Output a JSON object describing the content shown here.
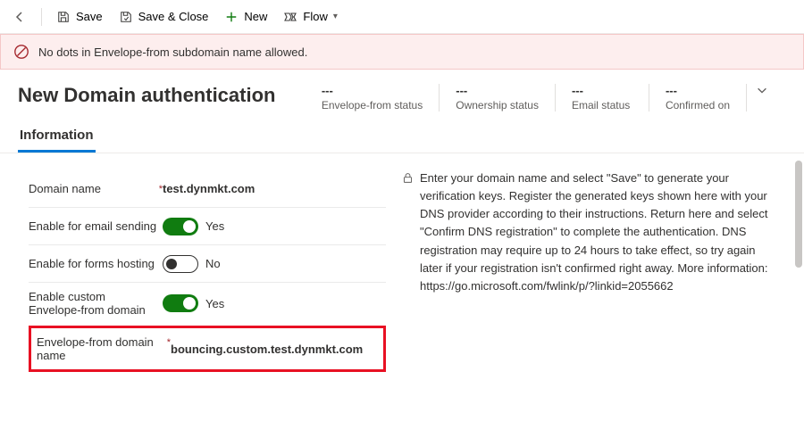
{
  "toolbar": {
    "save": "Save",
    "saveClose": "Save & Close",
    "new": "New",
    "flow": "Flow"
  },
  "error": {
    "message": "No dots in Envelope-from subdomain name allowed."
  },
  "page": {
    "title": "New Domain authentication"
  },
  "status": {
    "dash": "---",
    "labels": {
      "envelope": "Envelope-from status",
      "ownership": "Ownership status",
      "email": "Email status",
      "confirmed": "Confirmed on"
    }
  },
  "tabs": {
    "information": "Information"
  },
  "form": {
    "domainName": {
      "label": "Domain name",
      "value": "test.dynmkt.com"
    },
    "enableEmail": {
      "label": "Enable for email sending",
      "value": "Yes"
    },
    "enableForms": {
      "label": "Enable for forms hosting",
      "value": "No"
    },
    "enableCustomEnvelope": {
      "label": "Enable custom Envelope-from domain",
      "value": "Yes"
    },
    "envelopeDomain": {
      "label": "Envelope-from domain name",
      "value": "bouncing.custom.test.dynmkt.com"
    }
  },
  "help": {
    "text": "Enter your domain name and select \"Save\" to generate your verification keys. Register the generated keys shown here with your DNS provider according to their instructions. Return here and select \"Confirm DNS registration\" to complete the authentication. DNS registration may require up to 24 hours to take effect, so try again later if your registration isn't confirmed right away. More information: https://go.microsoft.com/fwlink/p/?linkid=2055662"
  }
}
